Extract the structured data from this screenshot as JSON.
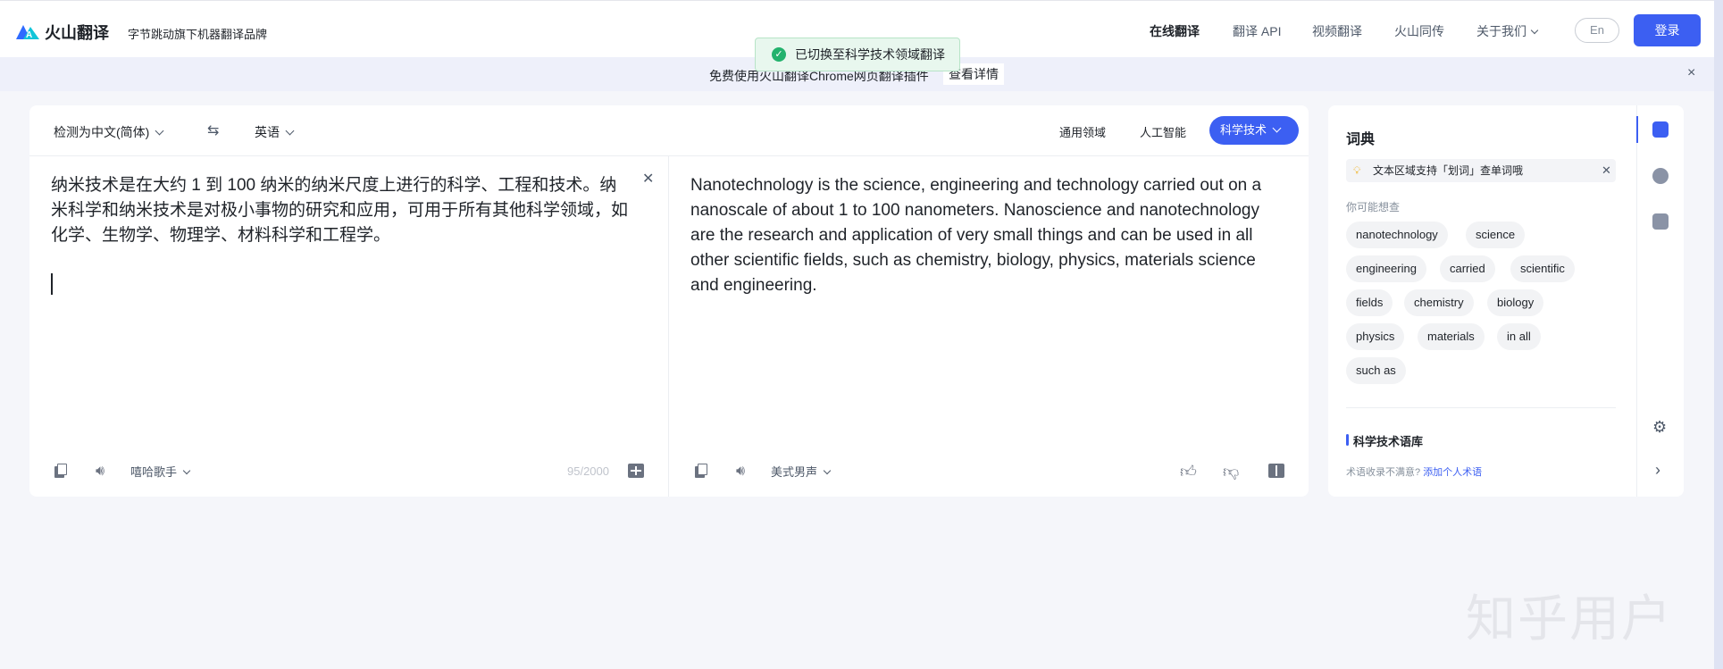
{
  "header": {
    "logo_text": "火山翻译",
    "slogan": "字节跳动旗下机器翻译品牌",
    "nav": [
      "在线翻译",
      "翻译 API",
      "视频翻译",
      "火山同传",
      "关于我们"
    ],
    "lang_button": "En",
    "login_button": "登录"
  },
  "toast": {
    "text": "已切换至科学技术领域翻译",
    "icon": "check-circle-icon"
  },
  "banner": {
    "text": "免费使用火山翻译Chrome网页翻译插件",
    "link": "查看详情",
    "close": "×"
  },
  "toolbar": {
    "source_lang": "检测为中文(简体)",
    "target_lang": "英语",
    "domains": [
      "通用领域",
      "人工智能"
    ],
    "active_domain": "科学技术"
  },
  "source": {
    "text": "纳米技术是在大约 1 到 100 纳米的纳米尺度上进行的科学、工程和技术。纳米科学和纳米技术是对极小事物的研究和应用，可用于所有其他科学领域，如化学、生物学、物理学、材料科学和工程学。",
    "voice": "嘻哈歌手",
    "count": "95/2000"
  },
  "target": {
    "text": "Nanotechnology is the science, engineering and technology carried out on a nanoscale of about 1 to 100 nanometers. Nanoscience and nanotechnology are the research and application of very small things and can be used in all other scientific fields, such as chemistry, biology, physics, materials science and engineering.",
    "voice": "美式男声"
  },
  "dictionary": {
    "title": "词典",
    "tip": "文本区域支持「划词」查单词哦",
    "maybe_label": "你可能想查",
    "words": [
      "nanotechnology",
      "science",
      "engineering",
      "carried",
      "scientific",
      "fields",
      "chemistry",
      "biology",
      "physics",
      "materials",
      "in all",
      "such as"
    ],
    "glossary_title": "科学技术语库",
    "glossary_note": "术语收录不满意?",
    "glossary_link": "添加个人术语"
  },
  "watermark": "知乎用户",
  "colors": {
    "accent": "#3c5ff2",
    "success": "#23b26d"
  }
}
